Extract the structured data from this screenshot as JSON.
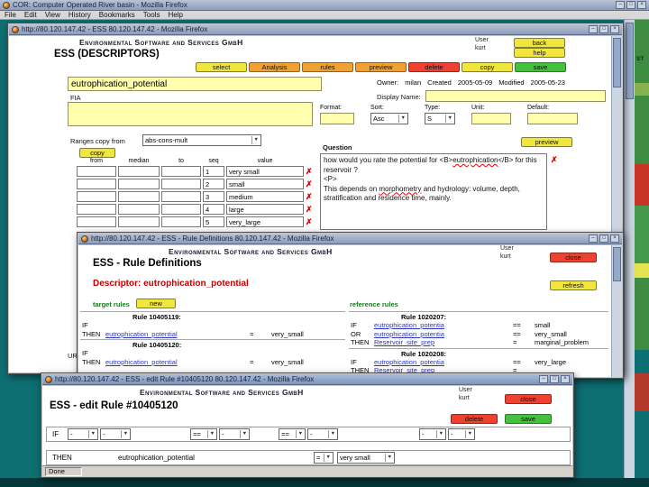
{
  "icons": {
    "dropdown": "▼",
    "delete_row": "✗",
    "minimize": "–",
    "maximize": "□",
    "close": "×"
  },
  "colors": {
    "desktop": "#0e6f73",
    "titlebar": "#8d9dba",
    "accent_yellow": "#f0e63e",
    "accent_orange": "#efa233",
    "accent_red": "#ee4130",
    "accent_green": "#43c03c",
    "field_yellow": "#ffffae",
    "link_blue": "#2a35c0",
    "label_green": "#17781c",
    "heading_red": "#c40000",
    "map_palette": [
      "#3d8c41",
      "#86b14e",
      "#c63526",
      "#e3e44f",
      "#b13a2c"
    ]
  },
  "cor_window": {
    "title": "COR: Computer Operated River basin - Mozilla Firefox",
    "menus": [
      "File",
      "Edit",
      "View",
      "History",
      "Bookmarks",
      "Tools",
      "Help"
    ],
    "map_label": "ST"
  },
  "descriptors_window": {
    "title": "http://80.120.147.42 - ESS 80.120.147.42 - Mozilla Firefox",
    "brand": "Environmental Software and Services GmbH",
    "user_label": "User",
    "user_name": "kurt",
    "back_button": "back",
    "help_button": "help",
    "page_title": "ESS (DESCRIPTORS)",
    "toolbar": {
      "select": "select",
      "analysis": "Analysis",
      "rules": "rules",
      "preview": "preview",
      "delete": "delete",
      "copy": "copy",
      "save": "save"
    },
    "name_value": "eutrophication_potential",
    "owner_label": "Owner:",
    "owner_value": "milan",
    "created_label": "Created",
    "created_value": "2005-05-09",
    "modified_label": "Modified",
    "modified_value": "2005-05-23",
    "display_name_label": "Display Name:",
    "fia_label": "FIA",
    "format_label": "Format:",
    "sort_label": "Sort:",
    "sort_value": "Asc",
    "type_label": "Type:",
    "type_value": "S",
    "unit_label": "Unit:",
    "default_label": "Default:",
    "ranges_label": "Ranges copy from",
    "ranges_value": "abs-cons-mult",
    "copy_button": "copy",
    "table": {
      "headers": [
        "from",
        "median",
        "to",
        "seq",
        "value"
      ],
      "rows": [
        {
          "seq": "1",
          "value": "very small"
        },
        {
          "seq": "2",
          "value": "small"
        },
        {
          "seq": "3",
          "value": "medium"
        },
        {
          "seq": "4",
          "value": "large"
        },
        {
          "seq": "5",
          "value": "very_large"
        }
      ]
    },
    "question_label": "Question",
    "preview_button": "preview",
    "question": {
      "part1": "how would you rate the potential for <B>",
      "word1": "eutrophication",
      "part2": "</B> for this reservoir ?",
      "part3": "<P>",
      "part4": "This depends on ",
      "word2": "morphometry",
      "part5": " and hydrology: volume, depth, stratification and residence time, mainly."
    },
    "url_label": "URL..."
  },
  "rules_window": {
    "title": "http://80.120.147.42 - ESS - Rule Definitions 80.120.147.42 - Mozilla Firefox",
    "brand": "Environmental Software and Services GmbH",
    "user_label": "User",
    "user_name": "kurt",
    "close_button": "close",
    "page_title": "ESS - Rule Definitions",
    "descriptor_heading": "Descriptor: eutrophication_potential",
    "refresh_button": "refresh",
    "target_rules_label": "target rules",
    "new_button": "new",
    "reference_rules_label": "reference rules",
    "target_rules": [
      {
        "id": "Rule 10405119:",
        "lines": [
          {
            "kw": "IF",
            "link": "",
            "op": "",
            "val": ""
          },
          {
            "kw": "THEN",
            "link": "eutrophication_potential",
            "op": "=",
            "val": "very_small"
          }
        ]
      },
      {
        "id": "Rule 10405120:",
        "lines": [
          {
            "kw": "IF",
            "link": "",
            "op": "",
            "val": ""
          },
          {
            "kw": "THEN",
            "link": "eutrophication_potential",
            "op": "=",
            "val": "very_small"
          }
        ]
      }
    ],
    "reference_rules": [
      {
        "id": "Rule 1020207:",
        "lines": [
          {
            "kw": "IF",
            "link": "eutrophication_potentia",
            "op": "==",
            "val": "small"
          },
          {
            "kw": "OR",
            "link": "eutrophication_potentia",
            "op": "==",
            "val": "very_small"
          },
          {
            "kw": "THEN",
            "link": "Reservoir_site_prep",
            "op": "=",
            "val": "marginal_problem"
          }
        ]
      },
      {
        "id": "Rule 1020208:",
        "lines": [
          {
            "kw": "IF",
            "link": "eutrophication_potentia",
            "op": "==",
            "val": "very_large"
          },
          {
            "kw": "THEN",
            "link": "Reservoir_site_prep",
            "op": "=",
            "val": ""
          }
        ]
      }
    ]
  },
  "edit_window": {
    "title": "http://80.120.147.42 - ESS - edit Rule #10405120 80.120.147.42 - Mozilla Firefox",
    "brand": "Environmental Software and Services GmbH",
    "user_label": "User",
    "user_name": "kurt",
    "close_button": "close",
    "delete_button": "delete",
    "save_button": "save",
    "page_title": "ESS - edit Rule #10405120",
    "if_label": "IF",
    "if_selects": [
      "-",
      "-",
      "==",
      "-",
      "==",
      "-",
      "-",
      "-"
    ],
    "then_label": "THEN",
    "then_target": "eutrophication_potential",
    "then_op": "=",
    "then_value": "very small",
    "status": "Done"
  }
}
